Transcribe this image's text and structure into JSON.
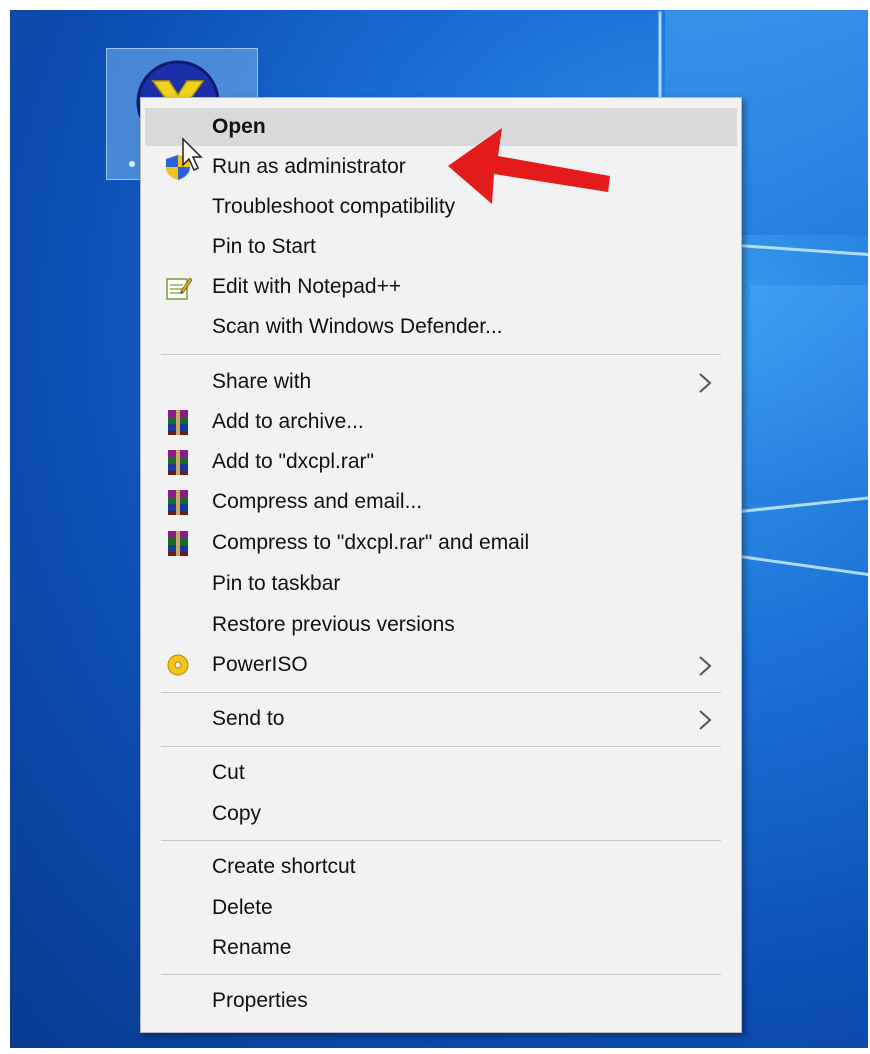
{
  "menu": {
    "items": [
      {
        "label": "Open",
        "icon": "none"
      },
      {
        "label": "Run as administrator",
        "icon": "uac-shield-icon"
      },
      {
        "label": "Troubleshoot compatibility",
        "icon": "none"
      },
      {
        "label": "Pin to Start",
        "icon": "none"
      },
      {
        "label": "Edit with Notepad++",
        "icon": "notepad-plus-plus-icon"
      },
      {
        "label": "Scan with Windows Defender...",
        "icon": "none"
      },
      {
        "label": "Share with",
        "icon": "none",
        "submenu": true
      },
      {
        "label": "Add to archive...",
        "icon": "winrar-icon"
      },
      {
        "label": "Add to \"dxcpl.rar\"",
        "icon": "winrar-icon"
      },
      {
        "label": "Compress and email...",
        "icon": "winrar-icon"
      },
      {
        "label": "Compress to \"dxcpl.rar\" and email",
        "icon": "winrar-icon"
      },
      {
        "label": "Pin to taskbar",
        "icon": "none"
      },
      {
        "label": "Restore previous versions",
        "icon": "none"
      },
      {
        "label": "PowerISO",
        "icon": "poweriso-icon",
        "submenu": true
      },
      {
        "label": "Send to",
        "icon": "none",
        "submenu": true
      },
      {
        "label": "Cut",
        "icon": "none"
      },
      {
        "label": "Copy",
        "icon": "none"
      },
      {
        "label": "Create shortcut",
        "icon": "none"
      },
      {
        "label": "Delete",
        "icon": "none"
      },
      {
        "label": "Rename",
        "icon": "none"
      },
      {
        "label": "Properties",
        "icon": "none"
      }
    ]
  },
  "colors": {
    "annotation_arrow": "#e31b1b",
    "menu_background": "#f2f2f2",
    "hover_background": "#d9d9d9",
    "desktop_blue": "#1a6fd6"
  }
}
